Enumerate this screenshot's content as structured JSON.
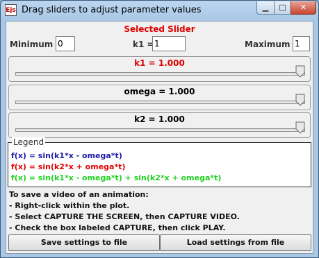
{
  "window": {
    "title": "Drag sliders to adjust parameter values",
    "icon_label": "Ejs"
  },
  "controls": {
    "minimize": "▁",
    "maximize": "□",
    "close": "✕"
  },
  "selected": {
    "title": "Selected Slider",
    "minimum_label": "Minimum =",
    "minimum_value": "0",
    "param_label": "k1 =",
    "param_value": "1",
    "maximum_label": "Maximum =",
    "maximum_value": "1"
  },
  "sliders": [
    {
      "label": "k1 = 1.000",
      "color": "#e00000",
      "value": 1.0,
      "min": 0,
      "max": 1
    },
    {
      "label": "omega = 1.000",
      "color": "#000000",
      "value": 1.0,
      "min": 0,
      "max": 1
    },
    {
      "label": "k2 = 1.000",
      "color": "#000000",
      "value": 1.0,
      "min": 0,
      "max": 1
    }
  ],
  "legend": {
    "title": "Legend",
    "lines": [
      {
        "text": "f(x) = sin(k1*x - omega*t)",
        "color": "#1a1aa6"
      },
      {
        "text": "f(x) = sin(k2*x + omega*t)",
        "color": "#e00000"
      },
      {
        "text": "f(x) = sin(k1*x - omega*t) + sin(k2*x + omega*t)",
        "color": "#1fd11f"
      }
    ]
  },
  "instructions": [
    "To save a video of an animation:",
    "- Right-click within the plot.",
    "- Select CAPTURE THE SCREEN, then CAPTURE VIDEO.",
    "- Check the box labeled CAPTURE, then click PLAY."
  ],
  "buttons": {
    "save": "Save settings to file",
    "load": "Load settings from file"
  }
}
